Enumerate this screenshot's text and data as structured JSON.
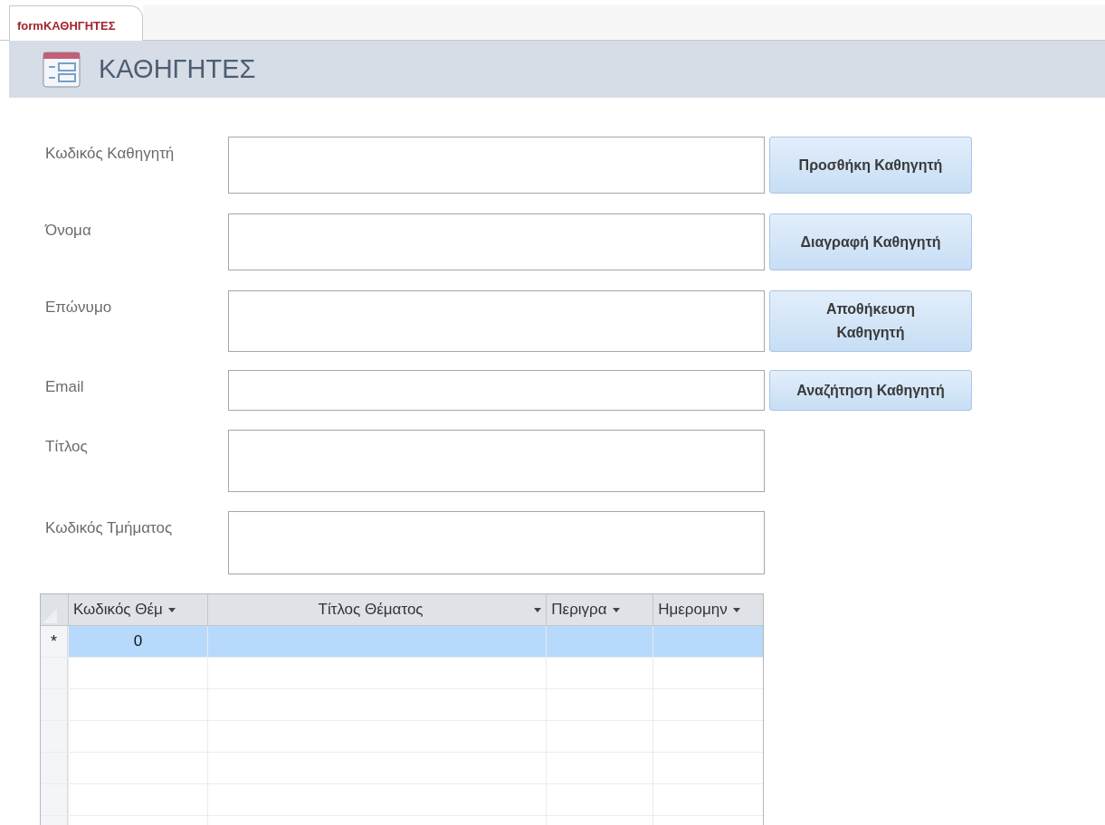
{
  "tab": {
    "title": "formΚΑΘΗΓΗΤΕΣ"
  },
  "header": {
    "title": "ΚΑΘΗΓΗΤΕΣ"
  },
  "fields": [
    {
      "label": "Κωδικός Καθηγητή"
    },
    {
      "label": "Όνομα"
    },
    {
      "label": "Επώνυμο"
    },
    {
      "label": "Email"
    },
    {
      "label": "Τίτλος"
    },
    {
      "label": "Κωδικός Τμήματος"
    }
  ],
  "buttons": [
    "Προσθήκη Καθηγητή",
    "Διαγραφή Καθηγητή",
    "Αποθήκευση Καθηγητή",
    "Αναζήτηση Καθηγητή"
  ],
  "subform": {
    "columns": [
      "Κωδικός Θέμ",
      "Τίτλος Θέματος",
      "Περιγρα",
      "Ημερομην"
    ],
    "rows": [
      {
        "marker": "*",
        "cells": [
          "0"
        ],
        "selected": true
      }
    ]
  }
}
